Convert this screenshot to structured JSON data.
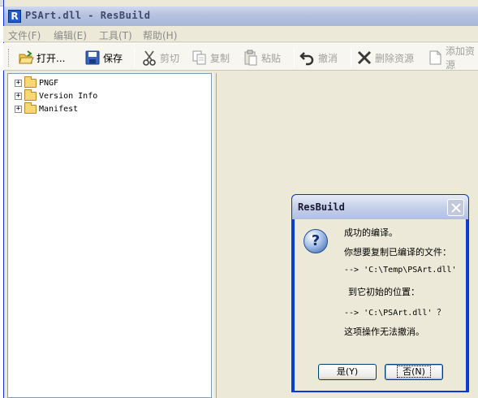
{
  "window": {
    "title": "PSArt.dll - ResBuild",
    "app_icon_letter": "R"
  },
  "menu": {
    "items": [
      "文件(F)",
      "编辑(E)",
      "工具(T)",
      "帮助(H)"
    ]
  },
  "toolbar": {
    "open_label": "打开...",
    "save_label": "保存",
    "cut_label": "剪切",
    "copy_label": "复制",
    "paste_label": "粘贴",
    "undo_label": "撤消",
    "delete_label": "删除资源",
    "add_label": "添加资源"
  },
  "tree": {
    "items": [
      "PNGF",
      "Version Info",
      "Manifest"
    ]
  },
  "dialog": {
    "title": "ResBuild",
    "icon": "question-icon",
    "icon_glyph": "?",
    "lines": [
      "成功的编译。",
      "你想要复制已编译的文件：",
      "--> 'C:\\Temp\\PSArt.dll'",
      "到它初始的位置：",
      "--> 'C:\\PSArt.dll' ？",
      "这项操作无法撤消。"
    ],
    "yes_label": "是(Y)",
    "no_label": "否(N)"
  },
  "colors": {
    "accent": "#0a3fd8",
    "folder": "#f8d775"
  }
}
